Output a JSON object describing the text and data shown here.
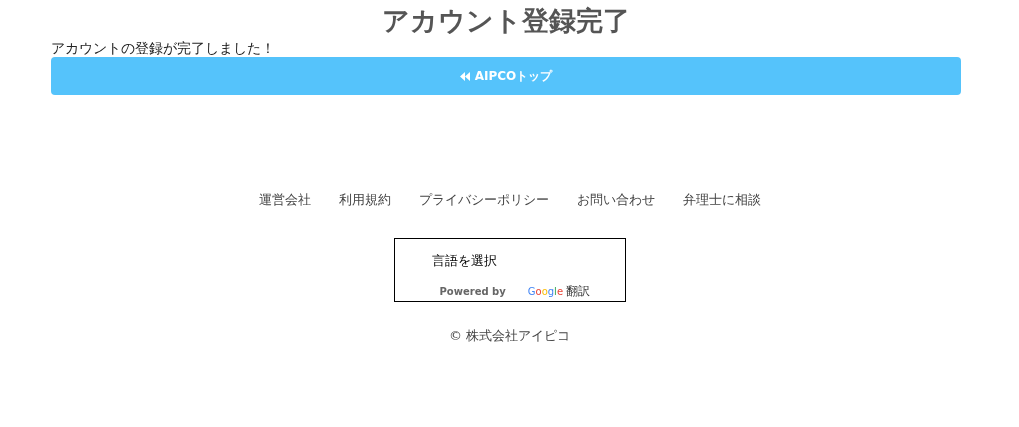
{
  "page": {
    "title": "アカウント登録完了",
    "message": "アカウントの登録が完了しました！",
    "top_button": {
      "label": "AIPCOトップ"
    }
  },
  "footer": {
    "links": [
      "運営会社",
      "利用規約",
      "プライバシーポリシー",
      "お問い合わせ",
      "弁理士に相談"
    ],
    "translate": {
      "select": "言語を選択",
      "powered_by": "Powered by",
      "brand": "Google",
      "service": "翻訳"
    },
    "copyright": "© 株式会社アイピコ"
  }
}
